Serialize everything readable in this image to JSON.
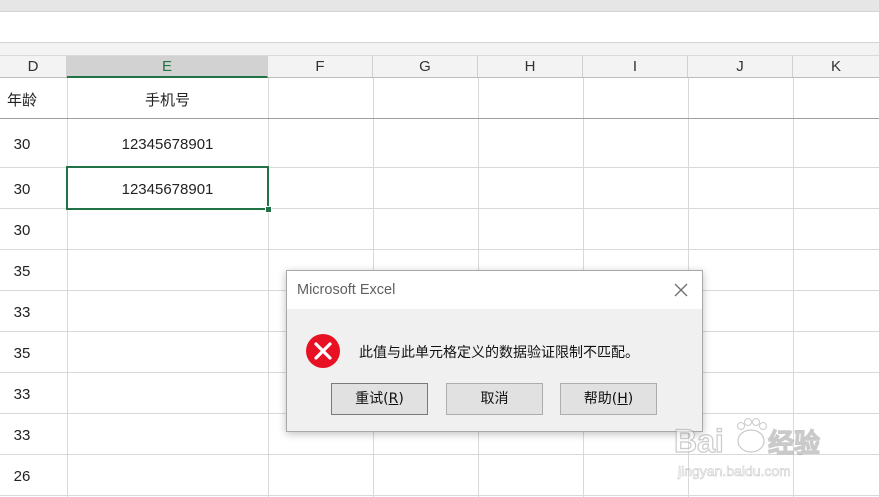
{
  "columns": [
    {
      "label": "D",
      "selected": false
    },
    {
      "label": "E",
      "selected": true
    },
    {
      "label": "F",
      "selected": false
    },
    {
      "label": "G",
      "selected": false
    },
    {
      "label": "H",
      "selected": false
    },
    {
      "label": "I",
      "selected": false
    },
    {
      "label": "J",
      "selected": false
    },
    {
      "label": "K",
      "selected": false
    }
  ],
  "sheet": {
    "header_row": {
      "age": "年龄",
      "phone": "手机号"
    },
    "rows": [
      {
        "age": "30",
        "phone": "12345678901"
      },
      {
        "age": "30",
        "phone": "12345678901"
      },
      {
        "age": "30",
        "phone": ""
      },
      {
        "age": "35",
        "phone": ""
      },
      {
        "age": "33",
        "phone": ""
      },
      {
        "age": "35",
        "phone": ""
      },
      {
        "age": "33",
        "phone": ""
      },
      {
        "age": "33",
        "phone": ""
      },
      {
        "age": "26",
        "phone": ""
      }
    ]
  },
  "dialog": {
    "title": "Microsoft Excel",
    "message": "此值与此单元格定义的数据验证限制不匹配。",
    "retry_label": "重试(",
    "retry_key": "R",
    "retry_close": ")",
    "cancel_label": "取消",
    "help_label": "帮助(",
    "help_key": "H",
    "help_close": ")",
    "icon": "error-icon"
  },
  "watermark": {
    "brand": "Bai",
    "brand_suffix": "经验",
    "url": "jingyan.baidu.com"
  },
  "colors": {
    "excel_green": "#217346",
    "error_red": "#e81123"
  }
}
